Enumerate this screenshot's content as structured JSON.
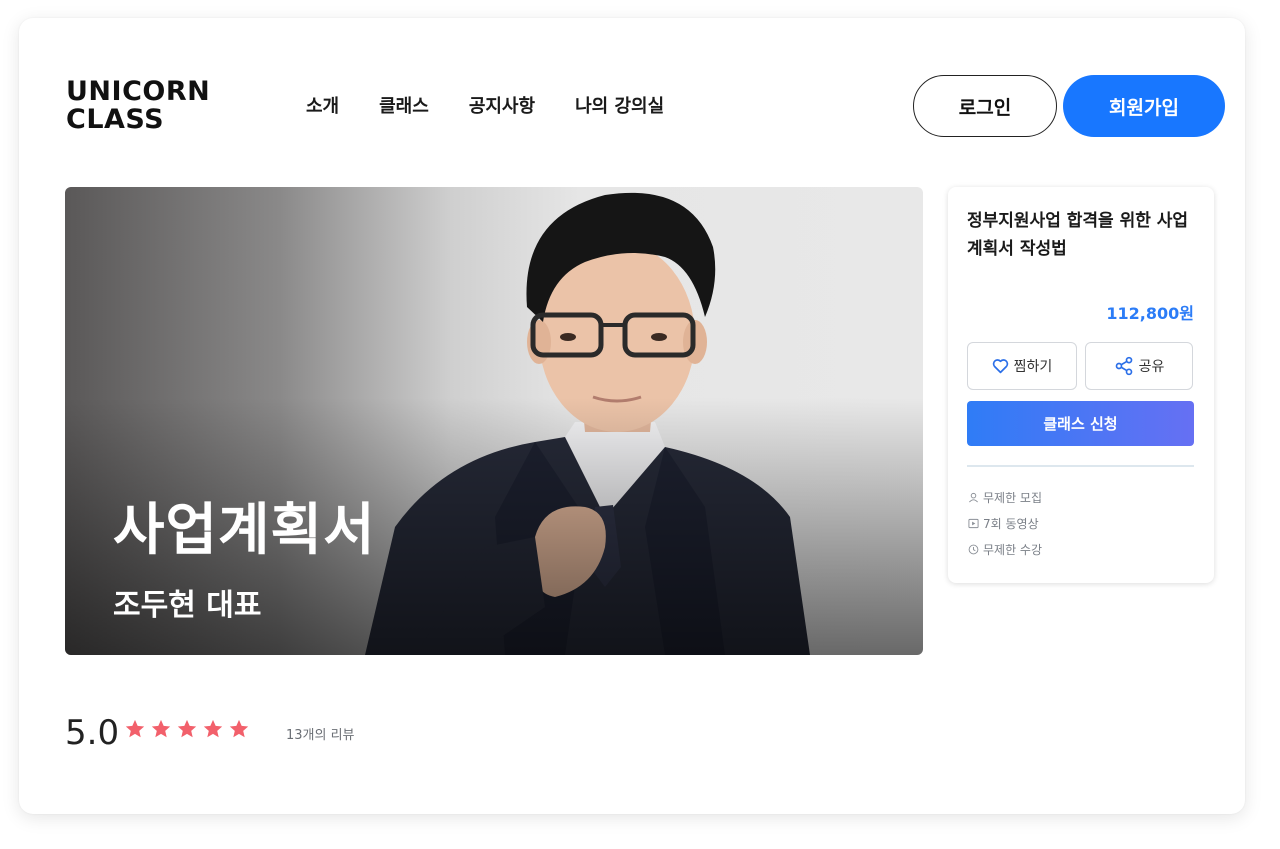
{
  "brand": {
    "line1": "UNICORN",
    "line2": "CLASS"
  },
  "nav": {
    "items": [
      "소개",
      "클래스",
      "공지사항",
      "나의 강의실"
    ]
  },
  "auth": {
    "login_label": "로그인",
    "signup_label": "회원가입"
  },
  "hero": {
    "title": "사업계획서",
    "subtitle": "조두현 대표"
  },
  "course": {
    "title": "정부지원사업 합격을 위한 사업계획서 작성법",
    "price": "112,800원",
    "like_label": "찜하기",
    "share_label": "공유",
    "apply_label": "클래스 신청",
    "features": [
      {
        "icon": "person-icon",
        "text": "무제한 모집"
      },
      {
        "icon": "play-icon",
        "text": "7회 동영상"
      },
      {
        "icon": "clock-icon",
        "text": "무제한 수강"
      }
    ]
  },
  "rating": {
    "score": "5.0",
    "stars": 5,
    "reviews": "13개의 리뷰"
  },
  "colors": {
    "primary": "#1877ff",
    "price": "#2b7cf7",
    "star": "#f2606b"
  }
}
